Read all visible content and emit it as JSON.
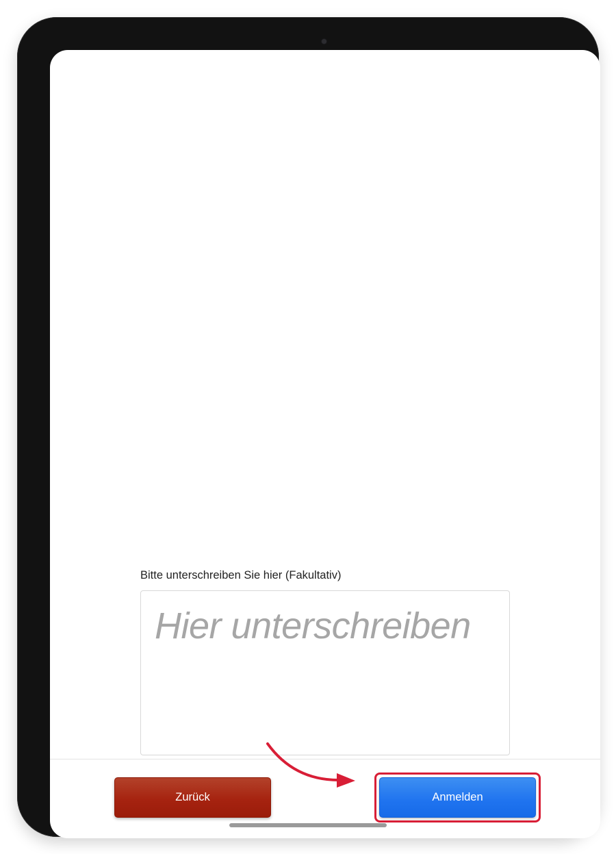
{
  "form": {
    "signature_label": "Bitte unterschreiben Sie hier (Fakultativ)",
    "signature_placeholder": "Hier unterschreiben"
  },
  "footer": {
    "back_label": "Zurück",
    "login_label": "Anmelden"
  },
  "colors": {
    "back_button": "#a62310",
    "login_button": "#1f73ef",
    "highlight": "#d81e36"
  }
}
